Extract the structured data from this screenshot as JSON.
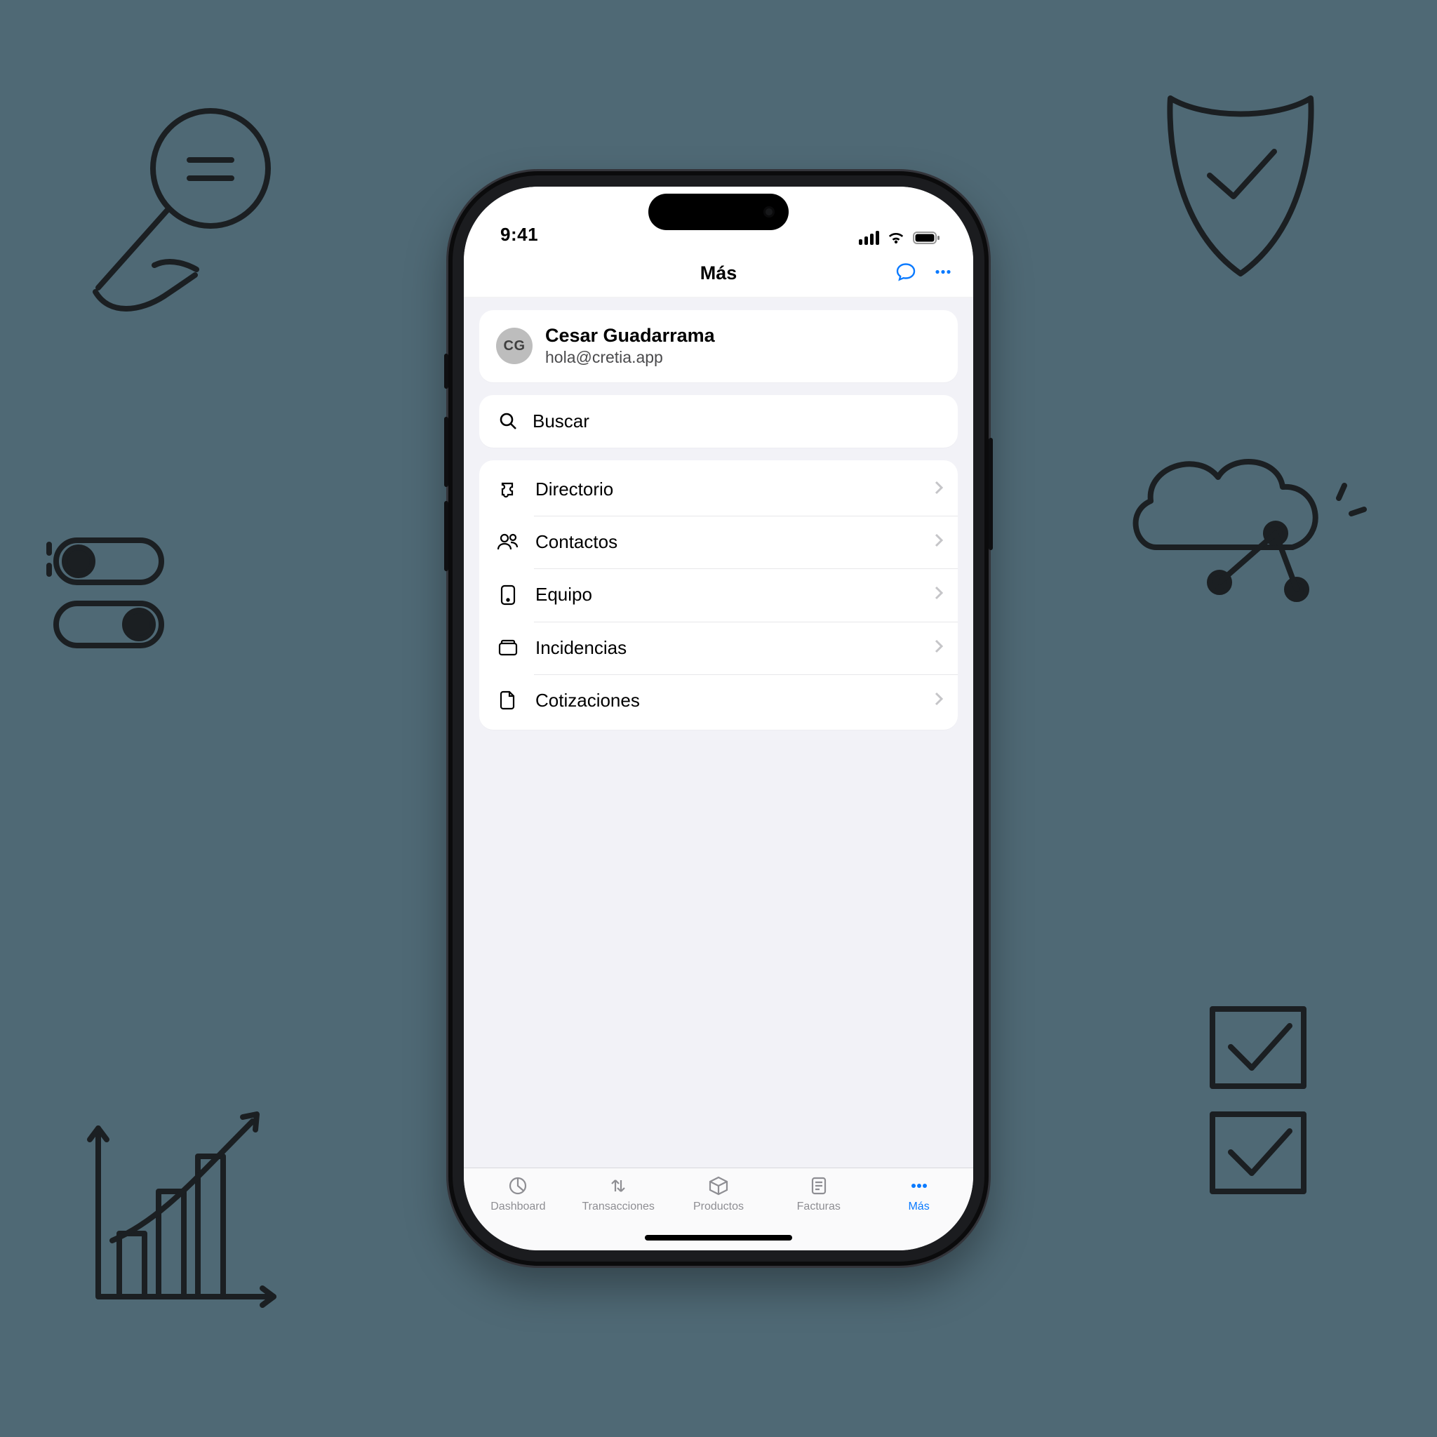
{
  "statusbar": {
    "time": "9:41"
  },
  "header": {
    "title": "Más"
  },
  "profile": {
    "initials": "CG",
    "name": "Cesar Guadarrama",
    "email": "hola@cretia.app"
  },
  "search": {
    "placeholder": "Buscar"
  },
  "menu": {
    "items": [
      {
        "label": "Directorio",
        "icon": "puzzle-icon"
      },
      {
        "label": "Contactos",
        "icon": "people-icon"
      },
      {
        "label": "Equipo",
        "icon": "device-icon"
      },
      {
        "label": "Incidencias",
        "icon": "inbox-icon"
      },
      {
        "label": "Cotizaciones",
        "icon": "document-icon"
      }
    ]
  },
  "tabs": {
    "items": [
      {
        "label": "Dashboard",
        "active": false
      },
      {
        "label": "Transacciones",
        "active": false
      },
      {
        "label": "Productos",
        "active": false
      },
      {
        "label": "Facturas",
        "active": false
      },
      {
        "label": "Más",
        "active": true
      }
    ]
  },
  "colors": {
    "accent": "#0a7aff",
    "muted": "#8e8e93",
    "bg": "#f2f2f7"
  }
}
